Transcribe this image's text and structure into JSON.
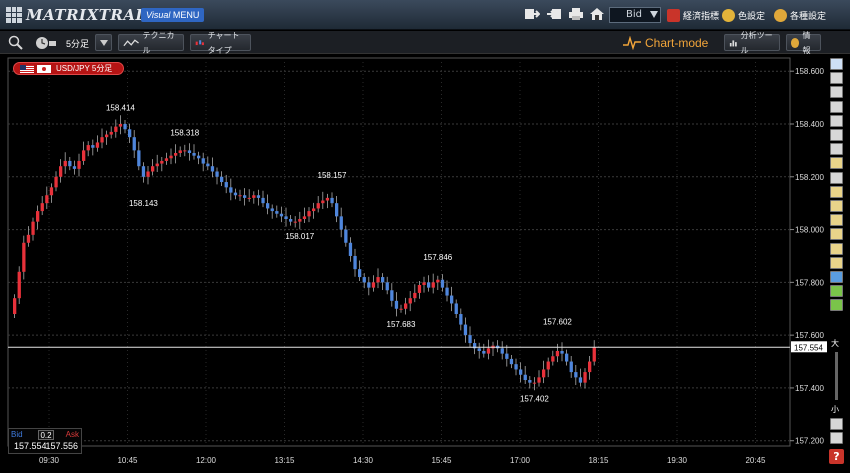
{
  "app": {
    "logo_text": "MATRIXTRADER",
    "menu_label_a": "Visual",
    "menu_label_b": "MENU",
    "price_type": "Bid",
    "economic_button": "経済指標",
    "color_button": "色設定",
    "settings_button": "各種設定"
  },
  "toolbar": {
    "timeframe": "5分足",
    "technical": "テクニカル",
    "chart_type": "チャートタイプ",
    "chart_mode": "Chart-mode",
    "analysis_tool": "分析ツール",
    "info": "情報"
  },
  "symbol_label": "USD/JPY 5分足",
  "rate_box": {
    "bid_label": "Bid",
    "ask_label": "Ask",
    "spread": "0.2",
    "bid_value": "157.554",
    "ask_value": "157.556"
  },
  "palette": {
    "zoom_in": "大",
    "zoom_out": "小",
    "help": "?"
  },
  "colors": {
    "up": "#e8313a",
    "down": "#4f86dc",
    "grid": "#3a3a3a",
    "chart_mode": "#f2a53a"
  },
  "chart_data": {
    "type": "candlestick",
    "symbol": "USD/JPY",
    "interval": "5分足",
    "y_ticks": [
      "158.600",
      "158.400",
      "158.200",
      "158.000",
      "157.800",
      "157.600",
      "157.400",
      "157.200"
    ],
    "ylim": [
      157.18,
      158.65
    ],
    "x_ticks": [
      "09:30",
      "10:45",
      "12:00",
      "13:15",
      "14:30",
      "15:45",
      "17:00",
      "18:15",
      "19:30",
      "20:45"
    ],
    "current_price": "157.554",
    "annotations": [
      {
        "label": "158.414",
        "kind": "high",
        "index": 23
      },
      {
        "label": "158.143",
        "kind": "low",
        "index": 28
      },
      {
        "label": "158.318",
        "kind": "high",
        "index": 37
      },
      {
        "label": "158.017",
        "kind": "low",
        "index": 62
      },
      {
        "label": "158.157",
        "kind": "high",
        "index": 69
      },
      {
        "label": "157.683",
        "kind": "low",
        "index": 84
      },
      {
        "label": "157.846",
        "kind": "high",
        "index": 92
      },
      {
        "label": "157.402",
        "kind": "low",
        "index": 113
      },
      {
        "label": "157.602",
        "kind": "high",
        "index": 118
      }
    ],
    "closes": [
      157.74,
      157.84,
      157.95,
      157.98,
      158.03,
      158.07,
      158.1,
      158.13,
      158.16,
      158.2,
      158.24,
      158.26,
      158.24,
      158.23,
      158.26,
      158.3,
      158.32,
      158.31,
      158.33,
      158.35,
      158.36,
      158.37,
      158.39,
      158.4,
      158.38,
      158.35,
      158.3,
      158.24,
      158.2,
      158.22,
      158.24,
      158.25,
      158.26,
      158.27,
      158.28,
      158.29,
      158.3,
      158.3,
      158.29,
      158.28,
      158.27,
      158.25,
      158.24,
      158.22,
      158.2,
      158.18,
      158.16,
      158.14,
      158.13,
      158.13,
      158.12,
      158.12,
      158.13,
      158.12,
      158.1,
      158.08,
      158.07,
      158.06,
      158.05,
      158.04,
      158.03,
      158.03,
      158.04,
      158.05,
      158.07,
      158.08,
      158.1,
      158.11,
      158.12,
      158.1,
      158.05,
      158.0,
      157.95,
      157.9,
      157.85,
      157.82,
      157.8,
      157.78,
      157.8,
      157.82,
      157.8,
      157.77,
      157.73,
      157.7,
      157.7,
      157.72,
      157.74,
      157.76,
      157.79,
      157.8,
      157.78,
      157.8,
      157.81,
      157.78,
      157.75,
      157.72,
      157.68,
      157.64,
      157.6,
      157.57,
      157.55,
      157.54,
      157.53,
      157.55,
      157.56,
      157.55,
      157.53,
      157.51,
      157.49,
      157.47,
      157.45,
      157.43,
      157.42,
      157.42,
      157.44,
      157.47,
      157.5,
      157.52,
      157.54,
      157.53,
      157.5,
      157.46,
      157.44,
      157.42,
      157.46,
      157.5,
      157.554
    ]
  }
}
